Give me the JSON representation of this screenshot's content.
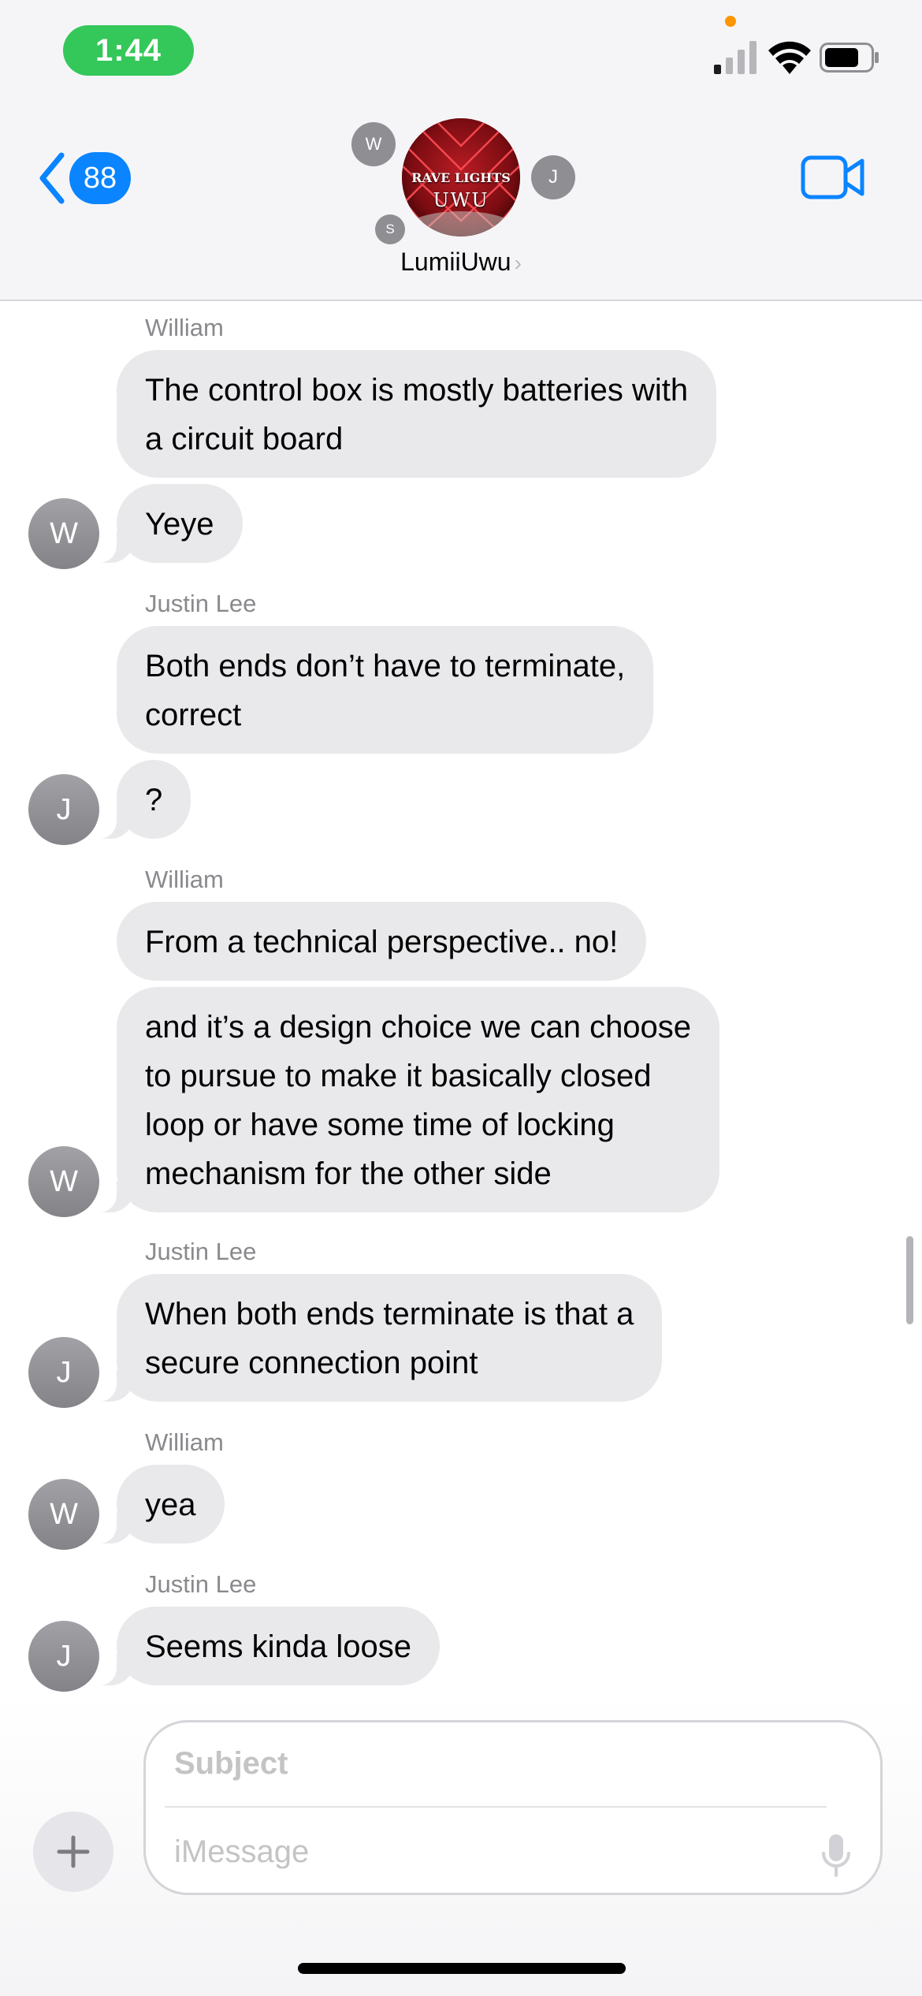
{
  "status_bar": {
    "time": "1:44"
  },
  "nav": {
    "back_count": "88",
    "group_name": "LumiiUwu",
    "group_avatar_line1": "RAVE LIGHTS",
    "group_avatar_line2": "UWU",
    "participant_initials": [
      "W",
      "J",
      "S"
    ]
  },
  "messages": [
    {
      "sender": "William",
      "text": "The control box is mostly batteries with\na circuit board"
    },
    {
      "text": "Yeye",
      "avatar": "W"
    },
    {
      "sender": "Justin Lee",
      "text": "Both ends don’t have to terminate,\ncorrect"
    },
    {
      "text": "?",
      "avatar": "J"
    },
    {
      "sender": "William",
      "text": "From a technical perspective.. no!"
    },
    {
      "text": "and it’s a design choice we can choose\nto pursue to make it basically closed\nloop or have some time of locking\nmechanism for the other side",
      "avatar": "W"
    },
    {
      "sender": "Justin Lee",
      "text": "When both ends terminate is that a\nsecure connection point",
      "avatar": "J"
    },
    {
      "sender": "William",
      "text": "yea",
      "avatar": "W"
    },
    {
      "sender": "Justin Lee",
      "text": "Seems kinda loose",
      "avatar": "J"
    }
  ],
  "composer": {
    "subject_placeholder": "Subject",
    "message_placeholder": "iMessage"
  },
  "colors": {
    "accent": "#0a84ff",
    "time_pill": "#34c759",
    "bubble_gray": "#e9e9eb"
  },
  "icons": {
    "back": "chevron-left-icon",
    "video": "video-camera-icon",
    "add": "plus-icon",
    "dictation": "microphone-icon"
  }
}
